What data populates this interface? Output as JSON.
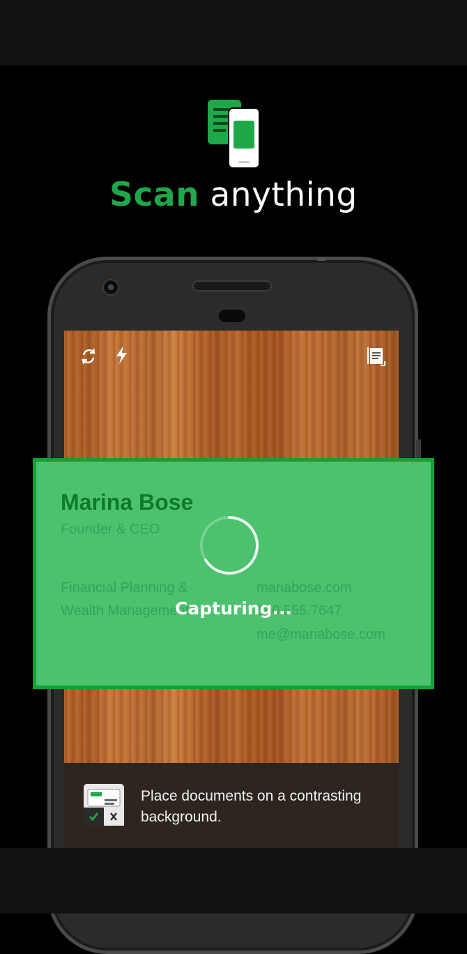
{
  "headline": {
    "accent": "Scan",
    "rest": " anything"
  },
  "card": {
    "name": "Marina Bose",
    "title": "Founder & CEO",
    "company_line1": "Financial Planning &",
    "company_line2": "Wealth Management",
    "website": "mariabose.com",
    "phone": "650.555.7647",
    "email": "me@mariabose.com"
  },
  "status": {
    "capturing": "Capturing..."
  },
  "tip": {
    "text": "Place documents on a contrasting background."
  },
  "toolbar": {
    "icons": [
      "auto-capture-icon",
      "flash-icon",
      "document-mode-icon"
    ]
  },
  "colors": {
    "accent": "#1fa84a",
    "card_border": "#12a134",
    "card_fill": "#4cc26e"
  }
}
